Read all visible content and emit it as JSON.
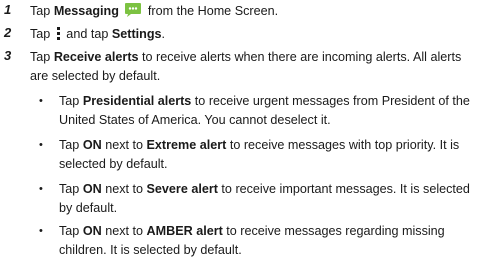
{
  "steps": [
    {
      "num": "1",
      "pre": "Tap ",
      "b1": "Messaging",
      "post": " from the Home Screen."
    },
    {
      "num": "2",
      "pre": "Tap ",
      "mid": " and tap ",
      "b1": "Settings",
      "post": "."
    },
    {
      "num": "3",
      "pre": "Tap ",
      "b1": "Receive alerts",
      "post": " to receive alerts when there are incoming alerts. All alerts are selected by default."
    }
  ],
  "bullets": [
    {
      "pre": "Tap ",
      "b1": "Presidential alerts",
      "post": " to receive urgent messages from President of the United States of America. You cannot deselect it."
    },
    {
      "pre": "Tap ",
      "b1": "ON",
      "mid": " next to ",
      "b2": "Extreme alert",
      "post": " to receive messages with top priority. It is selected by default."
    },
    {
      "pre": "Tap ",
      "b1": "ON",
      "mid": " next to ",
      "b2": "Severe alert",
      "post": " to receive important messages. It is selected by default."
    },
    {
      "pre": "Tap ",
      "b1": "ON",
      "mid": " next to ",
      "b2": "AMBER alert",
      "post": " to receive messages regarding missing children. It is selected by default."
    }
  ],
  "bullet_glyph": "•",
  "icons": {
    "messaging": "messaging-app-icon",
    "menu": "vertical-menu-icon"
  },
  "colors": {
    "text": "#1a1a1a",
    "messaging_icon": "#7cc242"
  }
}
